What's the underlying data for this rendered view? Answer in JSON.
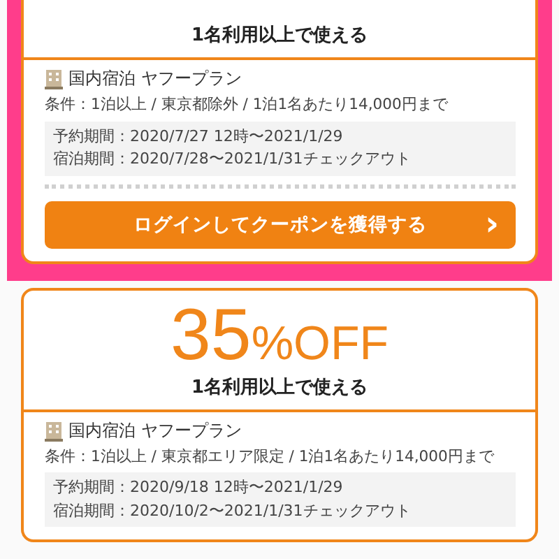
{
  "coupons": [
    {
      "highlighted": true,
      "subtitle": "1名利用以上で使える",
      "plan": "国内宿泊 ヤフープラン",
      "conditions": "条件：1泊以上 / 東京都除外 / 1泊1名あたり14,000円まで",
      "periods": [
        "予約期間：2020/7/27 12時〜2021/1/29",
        "宿泊期間：2020/7/28〜2021/1/31チェックアウト"
      ],
      "button": "ログインしてクーポンを獲得する",
      "button_arrow": "›"
    },
    {
      "highlighted": false,
      "discount_number": "35",
      "discount_unit": "%OFF",
      "subtitle": "1名利用以上で使える",
      "plan": "国内宿泊 ヤフープラン",
      "conditions": "条件：1泊以上 / 東京都エリア限定 / 1泊1名あたり14,000円まで",
      "periods": [
        "予約期間：2020/9/18 12時〜2021/1/29",
        "宿泊期間：2020/10/2〜2021/1/31チェックアウト"
      ]
    }
  ]
}
